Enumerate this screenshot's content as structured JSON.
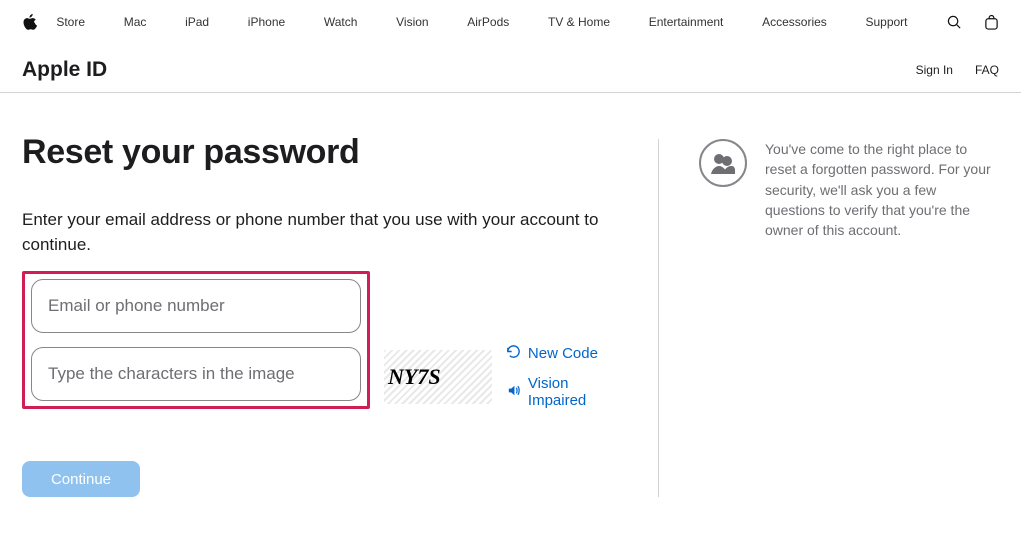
{
  "nav": {
    "items": [
      "Store",
      "Mac",
      "iPad",
      "iPhone",
      "Watch",
      "Vision",
      "AirPods",
      "TV & Home",
      "Entertainment",
      "Accessories",
      "Support"
    ]
  },
  "subheader": {
    "title": "Apple ID",
    "signin": "Sign In",
    "faq": "FAQ"
  },
  "page": {
    "title": "Reset your password",
    "instruction": "Enter your email address or phone number that you use with your account to continue."
  },
  "form": {
    "email_placeholder": "Email or phone number",
    "captcha_placeholder": "Type the characters in the image",
    "captcha_text": "NY7S",
    "new_code": "New Code",
    "vision_impaired": "Vision Impaired",
    "continue": "Continue"
  },
  "sidebar": {
    "help_text": "You've come to the right place to reset a forgotten password. For your security, we'll ask you a few questions to verify that you're the owner of this account."
  }
}
